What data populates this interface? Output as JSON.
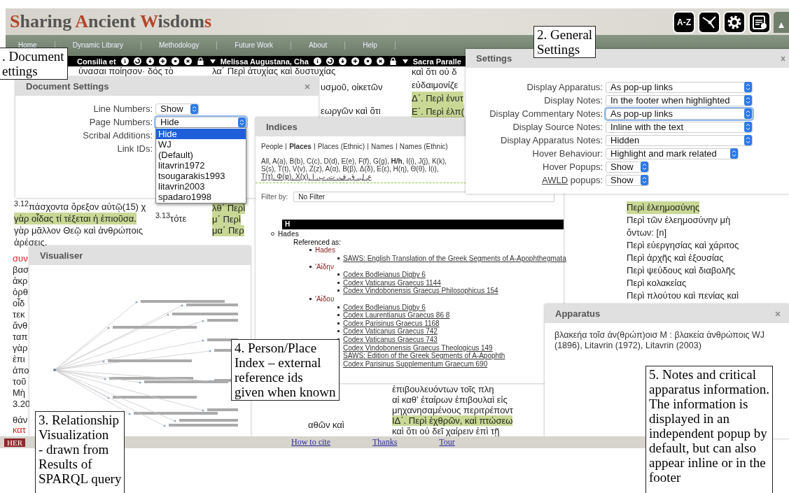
{
  "header": {
    "title": [
      {
        "text": "S",
        "accent": true
      },
      {
        "text": "haring ",
        "accent": false
      },
      {
        "text": "A",
        "accent": true
      },
      {
        "text": "ncient ",
        "accent": false
      },
      {
        "text": "W",
        "accent": true
      },
      {
        "text": "isdom",
        "accent": false
      },
      {
        "text": "s",
        "accent": true
      }
    ],
    "tools": [
      {
        "kind": "text",
        "label": "A-Z"
      },
      {
        "kind": "network"
      },
      {
        "kind": "gear"
      },
      {
        "kind": "document-add"
      },
      {
        "kind": "collapse"
      }
    ]
  },
  "nav": [
    "Home",
    "Dynamic Library",
    "Methodology",
    "Future Work",
    "About",
    "Help"
  ],
  "document_toolbar": [
    {
      "title": "Consilia et"
    },
    {
      "title": "Melissa Augustana, Cha"
    },
    {
      "title": "Sacra Paralle"
    }
  ],
  "text_blocks": [
    {
      "lines": [
        {
          "text": "ύνασαι ποίησον· δός τὸ",
          "highlight": false,
          "rubric": false
        }
      ]
    },
    {
      "lines": [
        {
          "text": "λα΄ Περὶ ἀτυχίας καὶ δυστυχίας",
          "highlight": false,
          "rubric": false
        }
      ]
    },
    {
      "lines": [
        {
          "text": "υσμοῦ, οἰκετῶν",
          "highlight": false,
          "rubric": false
        }
      ]
    },
    {
      "lines": [
        {
          "text": "εωργῶν καὶ ὅτι",
          "highlight": false,
          "rubric": false
        }
      ]
    },
    {
      "lines": [
        {
          "text": "καὶ ὅτι οὐ δ",
          "highlight": false,
          "rubric": false
        },
        {
          "text": "εὐδαιμονίζε",
          "highlight": false,
          "rubric": false
        },
        {
          "text": "Δ΄. Περὶ ἐνυτ",
          "highlight": true,
          "rubric": false
        },
        {
          "text": "Ε΄. Περὶ ἐλπ(",
          "highlight": true,
          "rubric": false
        }
      ]
    },
    {
      "lines": [
        {
          "text": "$^{3.12}$πάσχοντα ὄρεξον αὐτῷ(15) χ",
          "highlight": false,
          "rubric": false
        },
        {
          "text": "γὰρ οἶδας τί τέξεται ἡ ἐπιοῦσα.",
          "highlight": true,
          "rubric": false
        },
        {
          "text": "γὰρ μᾶλλον Θεῷ καὶ ἀνθρώποις",
          "highlight": false,
          "rubric": false
        },
        {
          "text": "ἀρέσεις.",
          "highlight": false,
          "rubric": false
        }
      ]
    },
    {
      "lines": [
        {
          "text": "$^{3.13}$τότε",
          "highlight": false,
          "rubric": false
        }
      ]
    },
    {
      "lines": [
        {
          "text": "λθ΄ Περὶ",
          "highlight": true,
          "rubric": false
        },
        {
          "text": "μ΄ Περὶ",
          "highlight": true,
          "rubric": false
        },
        {
          "text": "μα΄ Περ",
          "highlight": true,
          "rubric": false
        }
      ]
    },
    {
      "lines": [
        {
          "text": "συν",
          "highlight": false,
          "rubric": true
        },
        {
          "text": "βασ",
          "highlight": false,
          "rubric": false
        },
        {
          "text": "ἀκρ",
          "highlight": false,
          "rubric": false
        },
        {
          "text": "ὀρθ",
          "highlight": false,
          "rubric": false
        },
        {
          "text": "οἶδ",
          "highlight": false,
          "rubric": false
        },
        {
          "text": "τεκ",
          "highlight": false,
          "rubric": false
        },
        {
          "text": "ἄνθ",
          "highlight": false,
          "rubric": false
        },
        {
          "text": "ταπ",
          "highlight": false,
          "rubric": false
        },
        {
          "text": "γὰρ",
          "highlight": false,
          "rubric": false
        },
        {
          "text": "ἐπι",
          "highlight": false,
          "rubric": false
        },
        {
          "text": "ἀπο",
          "highlight": false,
          "rubric": false
        },
        {
          "text": "τοῦ",
          "highlight": false,
          "rubric": false
        },
        {
          "text": "Μὴ",
          "highlight": false,
          "rubric": false
        },
        {
          "text": "3.20",
          "highlight": false,
          "rubric": false
        }
      ]
    },
    {
      "lines": [
        {
          "text": "Περὶ ἐλεημοσύνης",
          "highlight": true,
          "rubric": false
        },
        {
          "text": "Περὶ τῶν ἐλεημοσύνην μὴ",
          "highlight": false,
          "rubric": false
        },
        {
          "text": "ὄντων: [n]",
          "highlight": false,
          "rubric": false
        },
        {
          "text": "Περὶ εὐεργησίας καὶ χάριτος",
          "highlight": false,
          "rubric": false
        },
        {
          "text": "Περὶ ἀρχῆς καὶ ἐξουσίας",
          "highlight": false,
          "rubric": false
        },
        {
          "text": "Περὶ ψεύδους καὶ διαβολῆς",
          "highlight": false,
          "rubric": false
        },
        {
          "text": "Περὶ κολακείας",
          "highlight": false,
          "rubric": false
        },
        {
          "text": "Περὶ πλούτου καὶ πενίας καὶ",
          "highlight": false,
          "rubric": false
        }
      ]
    },
    {
      "lines": [
        {
          "text": "θάν",
          "highlight": false,
          "rubric": false
        },
        {
          "text": "κατ",
          "highlight": false,
          "rubric": true
        }
      ]
    },
    {
      "lines": [
        {
          "text": "αθῶν καὶ",
          "highlight": false,
          "rubric": false
        }
      ]
    },
    {
      "lines": [
        {
          "text": "ἐπιβουλευόντων τοῖς πλη",
          "highlight": false,
          "rubric": false
        },
        {
          "text": "αἱ καθ' ἑταίρων ἐπιβουλαὶ εἰς",
          "highlight": false,
          "rubric": false
        },
        {
          "text": "μηχανησαμένους περιτρέποντ",
          "highlight": false,
          "rubric": false
        },
        {
          "text": "ΙΔ΄. Περὶ ἐχθρῶν, καὶ πτώσεω",
          "highlight": true,
          "rubric": false
        },
        {
          "text": "καὶ ὅτι οὐ δεῖ χαίρειν ἐπὶ τῇ",
          "highlight": false,
          "rubric": false
        }
      ]
    }
  ],
  "document_settings": {
    "title": "Document Settings",
    "closable": true,
    "rows": [
      {
        "label": "Line Numbers:",
        "value": "Show",
        "focused": false
      },
      {
        "label": "Page Numbers:",
        "value": "Hide",
        "focused": true,
        "options": [
          {
            "label": "Hide",
            "selected": true
          },
          {
            "label": "WJ",
            "selected": false
          },
          {
            "label": "(Default)",
            "selected": false
          },
          {
            "label": "litavrin1972",
            "selected": false
          },
          {
            "label": "tsougarakis1993",
            "selected": false
          },
          {
            "label": "litavrin2003",
            "selected": false
          },
          {
            "label": "spadaro1998",
            "selected": false
          }
        ]
      },
      {
        "label": "Scribal Additions:"
      },
      {
        "label": "Link IDs:"
      }
    ]
  },
  "indices": {
    "title": "Indices",
    "tabs": [
      {
        "label": "People",
        "selected": false
      },
      {
        "label": "Places",
        "selected": true
      },
      {
        "label": "Places (Ethnic)",
        "selected": false
      },
      {
        "label": "Names",
        "selected": false
      },
      {
        "label": "Names (Ethnic)",
        "selected": false
      }
    ],
    "letter_lines": [
      "All, A(a), B(b), C(c), D(d), E(e), F(f), G(g), **H/h**, I(i), J(j), K(k),",
      "S(s), T(t), V(v), Z(z), A(α), B(β), Δ(δ), E(ε), H(η), Θ(θ), I(ι),",
      "T(τ), Φ(φ), X(χ), ع, ل, ق, ف, ت, ب, ا"
    ],
    "filter_label": "Filter by:",
    "filter_value": "No Filter",
    "letter_heading": "H",
    "tree": [
      {
        "label": "Hades",
        "kind": "entry",
        "children": [
          {
            "label": "Referenced as:",
            "kind": "label",
            "children": [
              {
                "label": "Hades",
                "kind": "name",
                "children": [
                  {
                    "label": "SAWS: English Translation of the Greek Segments of A-Apophthegmata",
                    "kind": "link"
                  }
                ]
              },
              {
                "label": "'Αἰδην",
                "kind": "name",
                "children": [
                  {
                    "label": "Codex Bodleianus Digby 6",
                    "kind": "link"
                  },
                  {
                    "label": "Codex Vaticanus Graecus 1144",
                    "kind": "link"
                  },
                  {
                    "label": "Codex Vindobonensis Graecus Philosophicus 154",
                    "kind": "link"
                  }
                ]
              },
              {
                "label": "'Αἰδου",
                "kind": "name",
                "children": [
                  {
                    "label": "Codex Bodleianus Digby 6",
                    "kind": "link"
                  },
                  {
                    "label": "Codex Laurentianus Graecus 86 8",
                    "kind": "link"
                  },
                  {
                    "label": "Codex Parisinus Graecus 1168",
                    "kind": "link"
                  },
                  {
                    "label": "Codex Vaticanus Graecus 742",
                    "kind": "link"
                  },
                  {
                    "label": "Codex Vaticanus Graecus 743",
                    "kind": "link"
                  },
                  {
                    "label": "Codex Vindobonensis Graecus Theologicus 149",
                    "kind": "link"
                  },
                  {
                    "label": "SAWS: Edition of the Greek Segments of A-Apophth",
                    "kind": "link"
                  },
                  {
                    "label": "Codex Parisinus Supplementum Graecum 690",
                    "kind": "link"
                  }
                ]
              }
            ]
          }
        ]
      }
    ]
  },
  "settings": {
    "title": "Settings",
    "closable": true,
    "rows": [
      {
        "label": "Display Apparatus:",
        "value": "As pop-up links",
        "focused": false
      },
      {
        "label": "Display Notes:",
        "value": "In the footer when highlighted",
        "focused": false
      },
      {
        "label": "Display Commentary Notes:",
        "value": "As pop-up links",
        "focused": true
      },
      {
        "label": "Display Source Notes:",
        "value": "Inline with the text",
        "focused": false
      },
      {
        "label": "Display Apparatus Notes:",
        "value": "Hidden",
        "focused": false
      },
      {
        "label": "Hover Behaviour:",
        "value": "Highlight and mark related",
        "focused": false
      },
      {
        "label": "Hover Popups:",
        "value": "Show",
        "focused": false
      },
      {
        "label_link": "AWLD",
        "label": " popups:",
        "value": "Show",
        "focused": false
      }
    ]
  },
  "visualiser": {
    "title": "Visualiser",
    "closable": false
  },
  "apparatus": {
    "title": "Apparatus",
    "closable": true,
    "text": "βλακεήα τοῖσ ἀν(θρώπ)οισ M : βλακεία ἀνθρώποις WJ (1896), Litavrin (1972), Litavrin (2003)"
  },
  "footer": {
    "badge": "HER",
    "links": [
      "How to cite",
      "Thanks",
      "Tour"
    ]
  },
  "callouts": [
    {
      "lines": [
        ". Document",
        "ettings"
      ]
    },
    {
      "lines": [
        "2. General",
        "Settings"
      ]
    },
    {
      "lines": [
        "3. Relationship",
        "Visualization",
        "- drawn from",
        "Results of",
        "SPARQL query"
      ]
    },
    {
      "lines": [
        "4. Person/Place",
        "Index – external",
        "reference ids",
        "given when known"
      ]
    },
    {
      "lines": [
        "5. Notes and critical",
        "apparatus information.",
        "The information is",
        "displayed in an",
        "independent popup by",
        "default, but can also",
        "appear inline or in the",
        "footer"
      ]
    }
  ]
}
